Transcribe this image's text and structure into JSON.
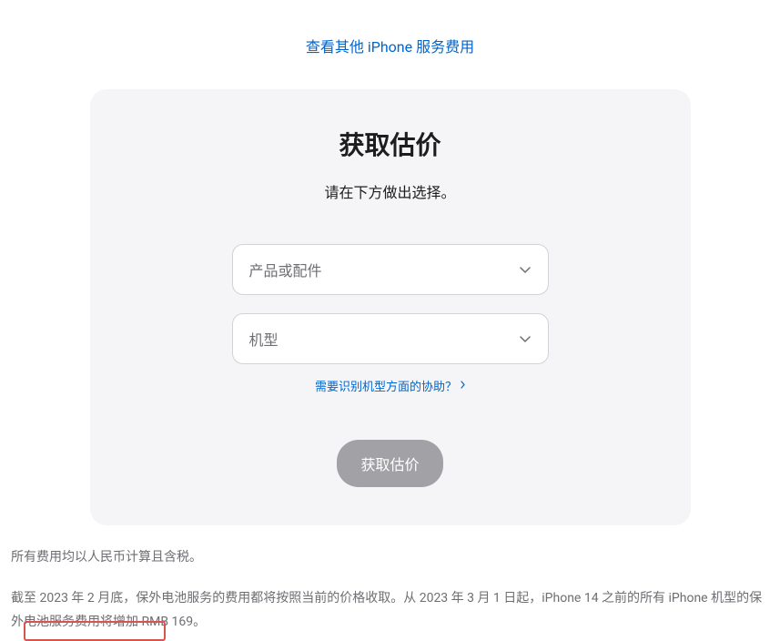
{
  "topLink": "查看其他 iPhone 服务费用",
  "card": {
    "title": "获取估价",
    "subtitle": "请在下方做出选择。",
    "select1": {
      "placeholder": "产品或配件"
    },
    "select2": {
      "placeholder": "机型"
    },
    "helpLink": "需要识别机型方面的协助？",
    "submitLabel": "获取估价"
  },
  "footnotes": {
    "line1": "所有费用均以人民币计算且含税。",
    "line2": "截至 2023 年 2 月底，保外电池服务的费用都将按照当前的价格收取。从 2023 年 3 月 1 日起，iPhone 14 之前的所有 iPhone 机型的保外电池服务费用将增加 RMB 169。"
  }
}
